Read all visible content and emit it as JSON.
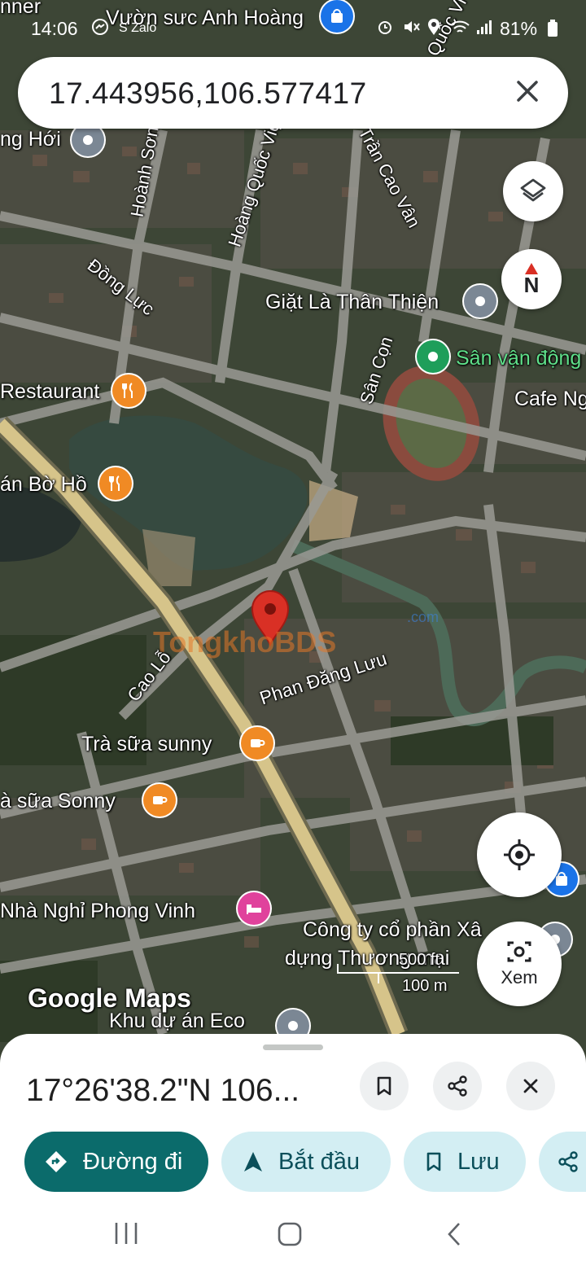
{
  "status_bar": {
    "time": "14:06",
    "battery": "81%",
    "apps": "S Zalo"
  },
  "search": {
    "query": "17.443956,106.577417"
  },
  "map": {
    "labels": {
      "top_partial": "nner",
      "vuon": "Vườn sưc Anh Hoàng",
      "dong_hoi": "ng Hới",
      "hoanh_son": "Hoành Sơn",
      "hoang_quoc_viet": "Hoàng Quốc Việt",
      "tran_cao_van": "Trần Cao Vân",
      "dong_luc": "Đồng Lực",
      "giat_la": "Giặt Là Thân Thiện",
      "san_con": "Sân Cọn",
      "san_van_dong": "Sân vận động",
      "cafe": "Cafe Ng",
      "restaurant": "Restaurant",
      "quan_bo_ho": "án Bờ Hồ",
      "cao_lo": "Cao Lỗ",
      "phan_dang_luu": "Phan Đăng Lưu",
      "tra_sua_sunny": "Trà sữa sunny",
      "tra_sua_sonny": "à sữa Sonny",
      "nha_nghi": "Nhà Nghỉ Phong Vinh",
      "cong_ty_1": "Công ty cổ phần Xâ",
      "cong_ty_2": "dựng Thương mại",
      "khu_du_an": "Khu dự án Eco",
      "quoc_vi": "Quốc Vi",
      "google_maps": "Google Maps",
      "watermark": "TongkhoBDS",
      "watermark_sub": ".com"
    },
    "scale": {
      "ft": "500 ft",
      "m": "100 m"
    },
    "compass": "N",
    "xem_label": "Xem"
  },
  "sheet": {
    "coordinates": "17°26'38.2\"N 106...",
    "buttons": {
      "directions": "Đường đi",
      "start": "Bắt đầu",
      "save": "Lưu"
    }
  },
  "colors": {
    "primary": "#0b6b6b",
    "secondary_bg": "#d3eef3",
    "pin": "#d93025"
  }
}
